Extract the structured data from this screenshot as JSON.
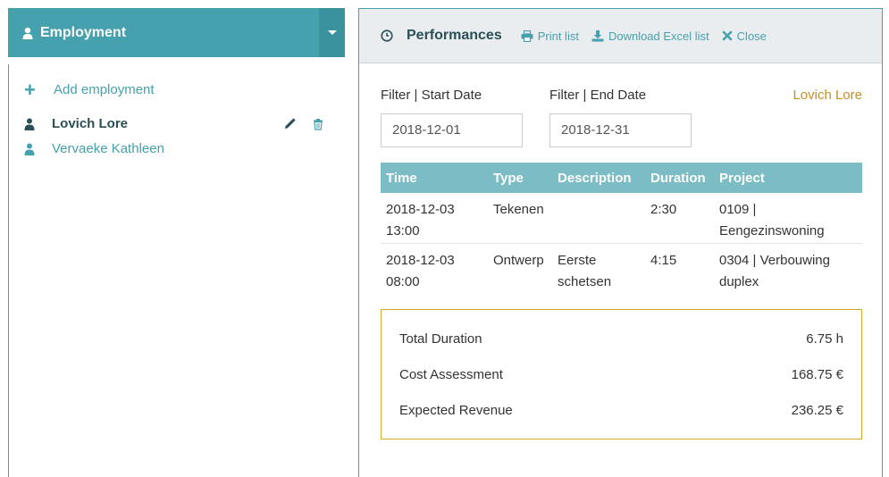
{
  "employment": {
    "title": "Employment",
    "add_label": "Add employment",
    "employees": [
      {
        "name": "Lovich Lore",
        "active": true
      },
      {
        "name": "Vervaeke Kathleen",
        "active": false
      }
    ]
  },
  "performances": {
    "title": "Performances",
    "print_label": "Print list",
    "download_label": "Download Excel list",
    "close_label": "Close",
    "filter_start_label": "Filter | Start Date",
    "filter_end_label": "Filter | End Date",
    "start_date": "2018-12-01",
    "end_date": "2018-12-31",
    "selected_employee": "Lovich Lore",
    "columns": [
      "Time",
      "Type",
      "Description",
      "Duration",
      "Project"
    ],
    "rows": [
      {
        "time_date": "2018-12-03",
        "time_clock": "13:00",
        "type": "Tekenen",
        "desc1": "",
        "desc2": "",
        "duration": "2:30",
        "proj1": "0109 |",
        "proj2": "Eengezinswoning"
      },
      {
        "time_date": "2018-12-03",
        "time_clock": "08:00",
        "type": "Ontwerp",
        "desc1": "Eerste",
        "desc2": "schetsen",
        "duration": "4:15",
        "proj1": "0304 | Verbouwing",
        "proj2": "duplex"
      }
    ],
    "summary": [
      {
        "label": "Total Duration",
        "value": "6.75 h"
      },
      {
        "label": "Cost Assessment",
        "value": "168.75 €"
      },
      {
        "label": "Expected Revenue",
        "value": "236.25 €"
      }
    ]
  },
  "colors": {
    "accent": "#45a1ad",
    "table_header": "#7bbcc5",
    "highlight": "#c4902c",
    "summary_border": "#d4a930"
  }
}
